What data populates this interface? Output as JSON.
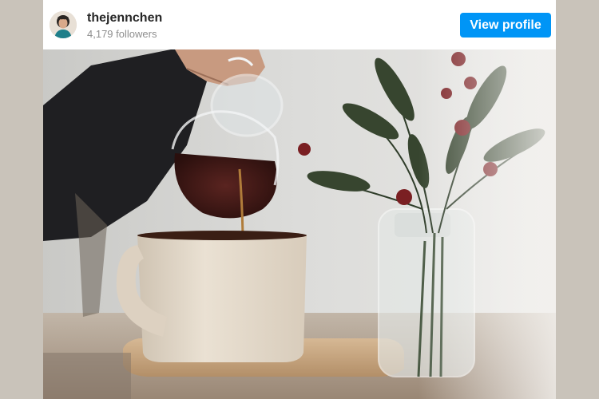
{
  "profile": {
    "username": "thejennchen",
    "followers": "4,179 followers",
    "avatar_icon": "avatar-photo"
  },
  "actions": {
    "view_profile_label": "View profile"
  },
  "post": {
    "image_icon": "coffee-pour-photo"
  },
  "colors": {
    "button": "#0095f6",
    "background": "#c9c3ba",
    "username": "#262626",
    "followers": "#8e8e8e"
  }
}
